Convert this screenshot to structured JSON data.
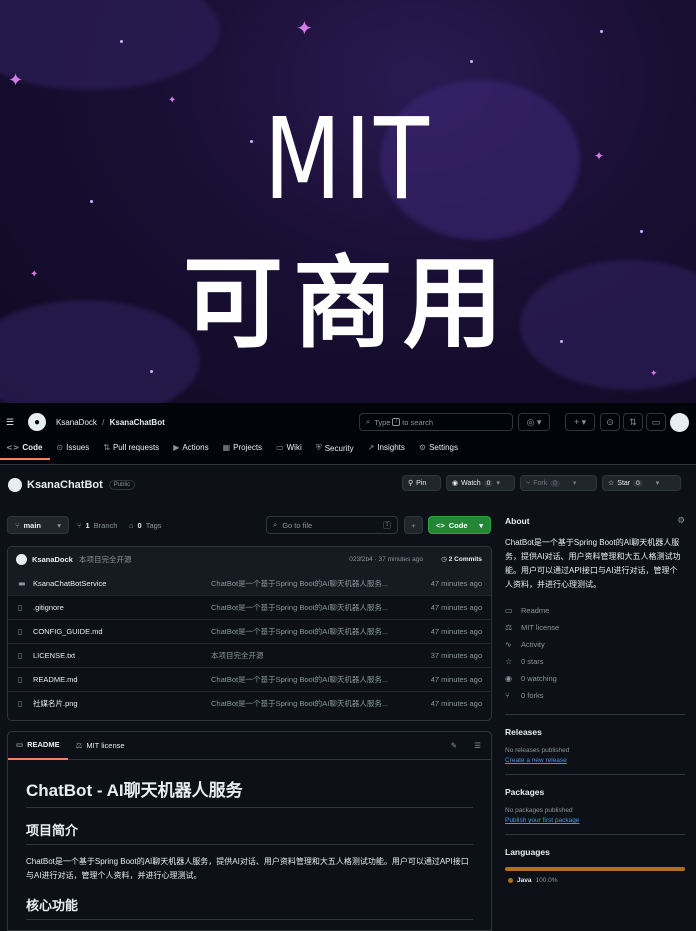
{
  "banner": {
    "line1": "MIT",
    "line2": "可商用"
  },
  "header": {
    "owner": "KsanaDock",
    "separator": "/",
    "repo": "KsanaChatBot",
    "search_placeholder_pre": "Type",
    "search_key": "/",
    "search_placeholder_post": "to search"
  },
  "nav": [
    {
      "icon": "<>",
      "label": "Code"
    },
    {
      "icon": "⊙",
      "label": "Issues"
    },
    {
      "icon": "⇅",
      "label": "Pull requests"
    },
    {
      "icon": "▶",
      "label": "Actions"
    },
    {
      "icon": "▦",
      "label": "Projects"
    },
    {
      "icon": "▭",
      "label": "Wiki"
    },
    {
      "icon": "⛨",
      "label": "Security"
    },
    {
      "icon": "↗",
      "label": "Insights"
    },
    {
      "icon": "⚙",
      "label": "Settings"
    }
  ],
  "repo": {
    "name": "KsanaChatBot",
    "visibility": "Public",
    "pin": "Pin",
    "watch": "Watch",
    "watch_count": "0",
    "fork": "Fork",
    "fork_count": "0",
    "star": "Star",
    "star_count": "0"
  },
  "toolbar": {
    "branch": "main",
    "branches_count": "1",
    "branches_label": "Branch",
    "tags_count": "0",
    "tags_label": "Tags",
    "goto_placeholder": "Go to file",
    "goto_key": "t",
    "add": "+",
    "code": "Code"
  },
  "commit": {
    "author": "KsanaDock",
    "message": "本项目完全开源",
    "meta": "023f2b4 · 37 minutes ago",
    "commits": "2 Commits"
  },
  "files": [
    {
      "icon": "folder",
      "name": "KsanaChatBotService",
      "msg": "ChatBot是一个基于Spring Boot的AI聊天机器人服务...",
      "time": "47 minutes ago"
    },
    {
      "icon": "file",
      "name": ".gitignore",
      "msg": "ChatBot是一个基于Spring Boot的AI聊天机器人服务...",
      "time": "47 minutes ago"
    },
    {
      "icon": "file",
      "name": "CONFIG_GUIDE.md",
      "msg": "ChatBot是一个基于Spring Boot的AI聊天机器人服务...",
      "time": "47 minutes ago"
    },
    {
      "icon": "file",
      "name": "LICENSE.txt",
      "msg": "本项目完全开源",
      "time": "37 minutes ago"
    },
    {
      "icon": "file",
      "name": "README.md",
      "msg": "ChatBot是一个基于Spring Boot的AI聊天机器人服务...",
      "time": "47 minutes ago"
    },
    {
      "icon": "file",
      "name": "社媒名片.png",
      "msg": "ChatBot是一个基于Spring Boot的AI聊天机器人服务...",
      "time": "47 minutes ago"
    }
  ],
  "readme": {
    "tab_readme": "README",
    "tab_license": "MIT license",
    "h1": "ChatBot - AI聊天机器人服务",
    "h2_intro": "项目简介",
    "intro": "ChatBot是一个基于Spring Boot的AI聊天机器人服务，提供AI对话、用户资料管理和大五人格测试功能。用户可以通过API接口与AI进行对话，管理个人资料，并进行心理测试。",
    "h2_features": "核心功能"
  },
  "about": {
    "title": "About",
    "desc": "ChatBot是一个基于Spring Boot的AI聊天机器人服务，提供AI对话、用户资料管理和大五人格测试功能。用户可以通过API接口与AI进行对话，管理个人资料，并进行心理测试。",
    "items": [
      {
        "icon": "▭",
        "label": "Readme"
      },
      {
        "icon": "⚖",
        "label": "MIT license"
      },
      {
        "icon": "∿",
        "label": "Activity"
      },
      {
        "icon": "☆",
        "label": "0 stars"
      },
      {
        "icon": "◉",
        "label": "0 watching"
      },
      {
        "icon": "⑂",
        "label": "0 forks"
      }
    ]
  },
  "releases": {
    "title": "Releases",
    "none": "No releases published",
    "link": "Create a new release"
  },
  "packages": {
    "title": "Packages",
    "none": "No packages published",
    "link": "Publish your first package"
  },
  "languages": {
    "title": "Languages",
    "name": "Java",
    "percent": "100.0%",
    "color": "#b07219"
  }
}
